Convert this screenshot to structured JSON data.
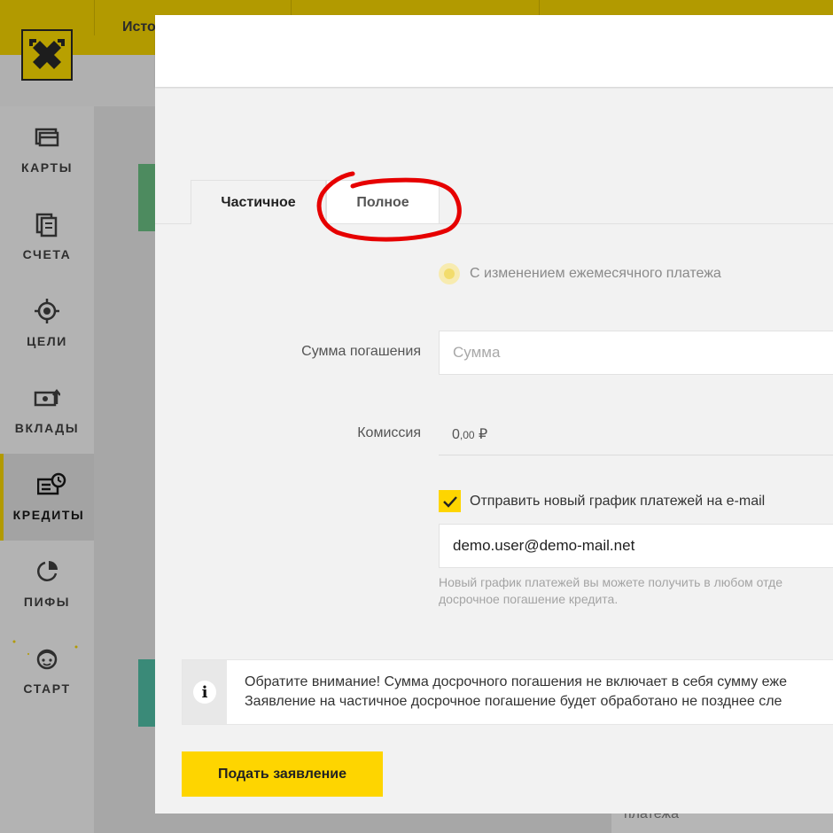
{
  "topbar": {
    "partial_nav_label": "Исто"
  },
  "sidebar": {
    "items": [
      {
        "label": "КАРТЫ",
        "icon": "cards-icon",
        "active": false
      },
      {
        "label": "СЧЕТА",
        "icon": "accounts-icon",
        "active": false
      },
      {
        "label": "ЦЕЛИ",
        "icon": "goals-icon",
        "active": false
      },
      {
        "label": "ВКЛАДЫ",
        "icon": "deposits-icon",
        "active": false
      },
      {
        "label": "КРЕДИТЫ",
        "icon": "credits-icon",
        "active": true
      },
      {
        "label": "ПИФЫ",
        "icon": "funds-icon",
        "active": false
      },
      {
        "label": "СТАРТ",
        "icon": "start-icon",
        "active": false
      }
    ]
  },
  "background": {
    "partial_text": "платежа"
  },
  "modal": {
    "tabs": [
      {
        "label": "Частичное",
        "active": true
      },
      {
        "label": "Полное",
        "active": false
      }
    ],
    "radio_option": {
      "label": "С изменением ежемесячного платежа",
      "selected": true
    },
    "amount": {
      "label": "Сумма погашения",
      "placeholder": "Сумма",
      "value": ""
    },
    "fee": {
      "label": "Комиссия",
      "integer": "0",
      "fraction": ",00",
      "currency": "₽"
    },
    "email_checkbox": {
      "label": "Отправить новый график платежей на e-mail",
      "checked": true
    },
    "email": {
      "value": "demo.user@demo-mail.net"
    },
    "hint": {
      "line1": "Новый график платежей вы можете получить в любом отде",
      "line2": "досрочное погашение кредита."
    },
    "notice": {
      "line1": "Обратите внимание! Сумма досрочного погашения не включает в себя сумму еже",
      "line2": "Заявление на частичное досрочное погашение будет обработано не позднее сле"
    },
    "submit_label": "Подать заявление"
  },
  "colors": {
    "brand_yellow": "#fed500",
    "annotation_red": "#e60000",
    "overlay_grey": "#a7a7a7"
  }
}
